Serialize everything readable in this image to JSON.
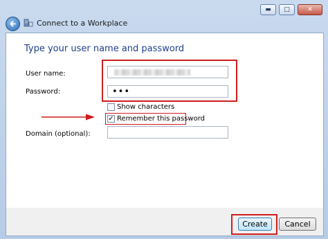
{
  "window": {
    "title": "Connect to a Workplace",
    "caption": {
      "minimize": "▬",
      "maximize": "□",
      "close": "✕"
    }
  },
  "form": {
    "heading": "Type your user name and password",
    "username_label": "User name:",
    "password_label": "Password:",
    "password_value": "•••",
    "show_characters_label": "Show characters",
    "show_characters_checked": false,
    "remember_label": "Remember this password",
    "remember_checked": true,
    "remember_check_glyph": "✓",
    "domain_label": "Domain (optional):",
    "domain_value": ""
  },
  "buttons": {
    "create": "Create",
    "cancel": "Cancel"
  },
  "annotations": {
    "highlight_color": "#d01c1c"
  }
}
